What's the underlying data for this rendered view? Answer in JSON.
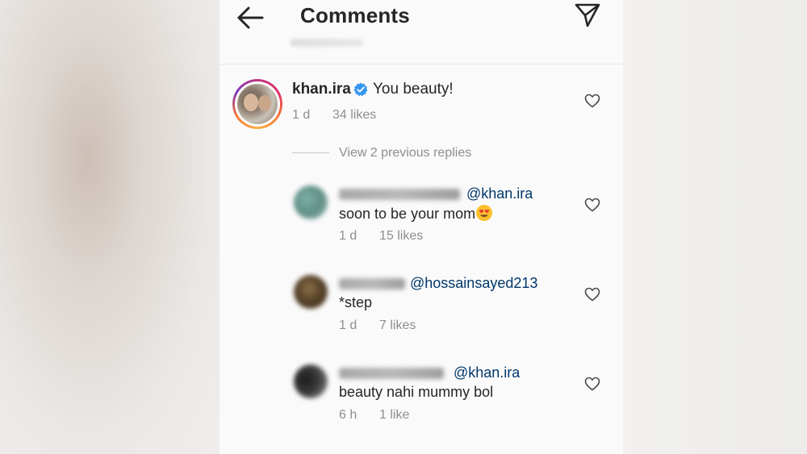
{
  "header": {
    "title": "Comments"
  },
  "main_comment": {
    "username": "khan.ira",
    "verified": true,
    "text": "You beauty!",
    "time": "1 d",
    "likes": "34 likes"
  },
  "view_previous": "View 2 previous replies",
  "replies": [
    {
      "mention": "@khan.ira",
      "text": "soon to be your mom",
      "emoji": "heart-eyes-emoji",
      "time": "1 d",
      "likes": "15 likes"
    },
    {
      "mention": "@hossainsayed213",
      "text": "*step",
      "time": "1 d",
      "likes": "7 likes"
    },
    {
      "mention": "@khan.ira",
      "text": "beauty nahi mummy bol",
      "time": "6 h",
      "likes": "1 like"
    }
  ],
  "colors": {
    "text_primary": "#262626",
    "text_secondary": "#8e8e8e",
    "mention": "#00376b",
    "verified": "#3897f0"
  },
  "icons": {
    "back": "arrow-left-icon",
    "send": "send-direct-icon",
    "like": "heart-outline-icon",
    "verified": "verified-badge-icon"
  }
}
